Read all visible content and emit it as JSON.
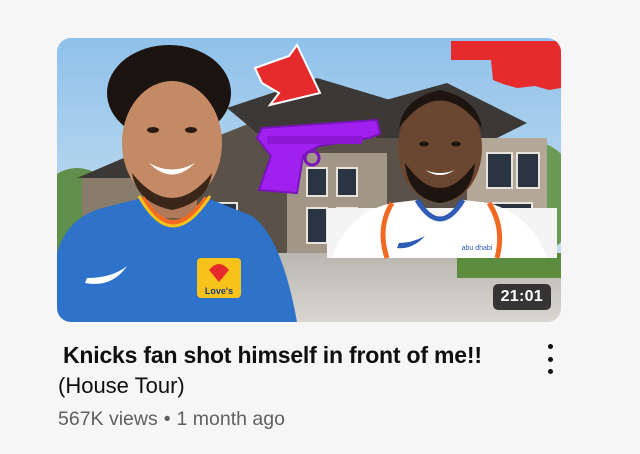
{
  "video": {
    "title": "Knicks fan shot himself in front of me!!",
    "subtitle": "(House Tour)",
    "views": "567K views",
    "separator": "•",
    "age": "1 month ago",
    "duration": "21:01",
    "menu_icon": "more-vertical-icon"
  },
  "thumbnail": {
    "jersey_left_text": "Love's",
    "jersey_right_text": "abu dhabi",
    "colors": {
      "sky": "#9fc8e8",
      "house": "#4a4540",
      "gun": "#a020f0",
      "arrow": "#e52b2b",
      "state_shape": "#e52b2b",
      "thunder_blue": "#2e73c9",
      "knicks_orange": "#f26a21"
    }
  },
  "colors": {
    "background": "#f6f6f6",
    "title_text": "#0f0f0f",
    "meta_text": "#606060",
    "duration_bg": "#141414"
  }
}
